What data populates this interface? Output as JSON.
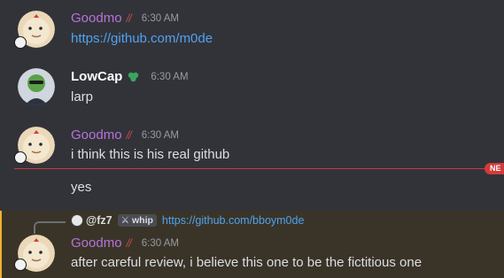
{
  "messages": [
    {
      "author": "Goodmo",
      "tag": "//",
      "time": "6:30 AM",
      "text": "https://github.com/m0de"
    },
    {
      "author": "LowCap",
      "time": "6:30 AM",
      "text": "larp"
    },
    {
      "author": "Goodmo",
      "tag": "//",
      "time": "6:30 AM",
      "text": "i think this is his real github",
      "followup": "yes"
    },
    {
      "reply": {
        "author": "@fz7",
        "badge": "whip",
        "text": "https://github.com/bboym0de"
      },
      "author": "Goodmo",
      "tag": "//",
      "time": "6:30 AM",
      "text": "after careful review, i believe this one to be the fictitious one"
    }
  ],
  "new_divider": "NE",
  "colors": {
    "background": "#323339",
    "username_purple": "#b673d9",
    "link": "#4fa3ee",
    "new_divider": "#c63b3b",
    "mention_highlight": "#3a3428"
  }
}
